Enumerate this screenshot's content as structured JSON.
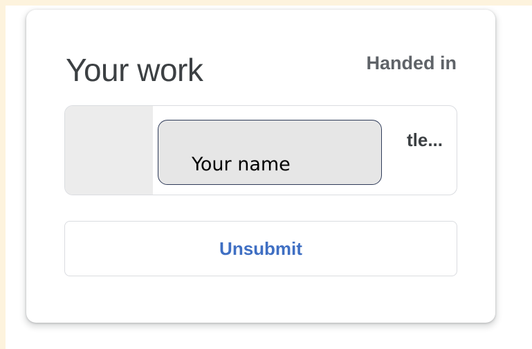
{
  "card": {
    "title": "Your work",
    "status": "Handed in"
  },
  "attachment": {
    "title_visible": "tle..."
  },
  "overlay": {
    "label": "Your name"
  },
  "actions": {
    "unsubmit_label": "Unsubmit"
  },
  "colors": {
    "accent_link": "#3f6fc3",
    "frame_bg": "#fdf3dd",
    "overlay_bg": "#e6e6e6",
    "overlay_border": "#2f3b59"
  }
}
